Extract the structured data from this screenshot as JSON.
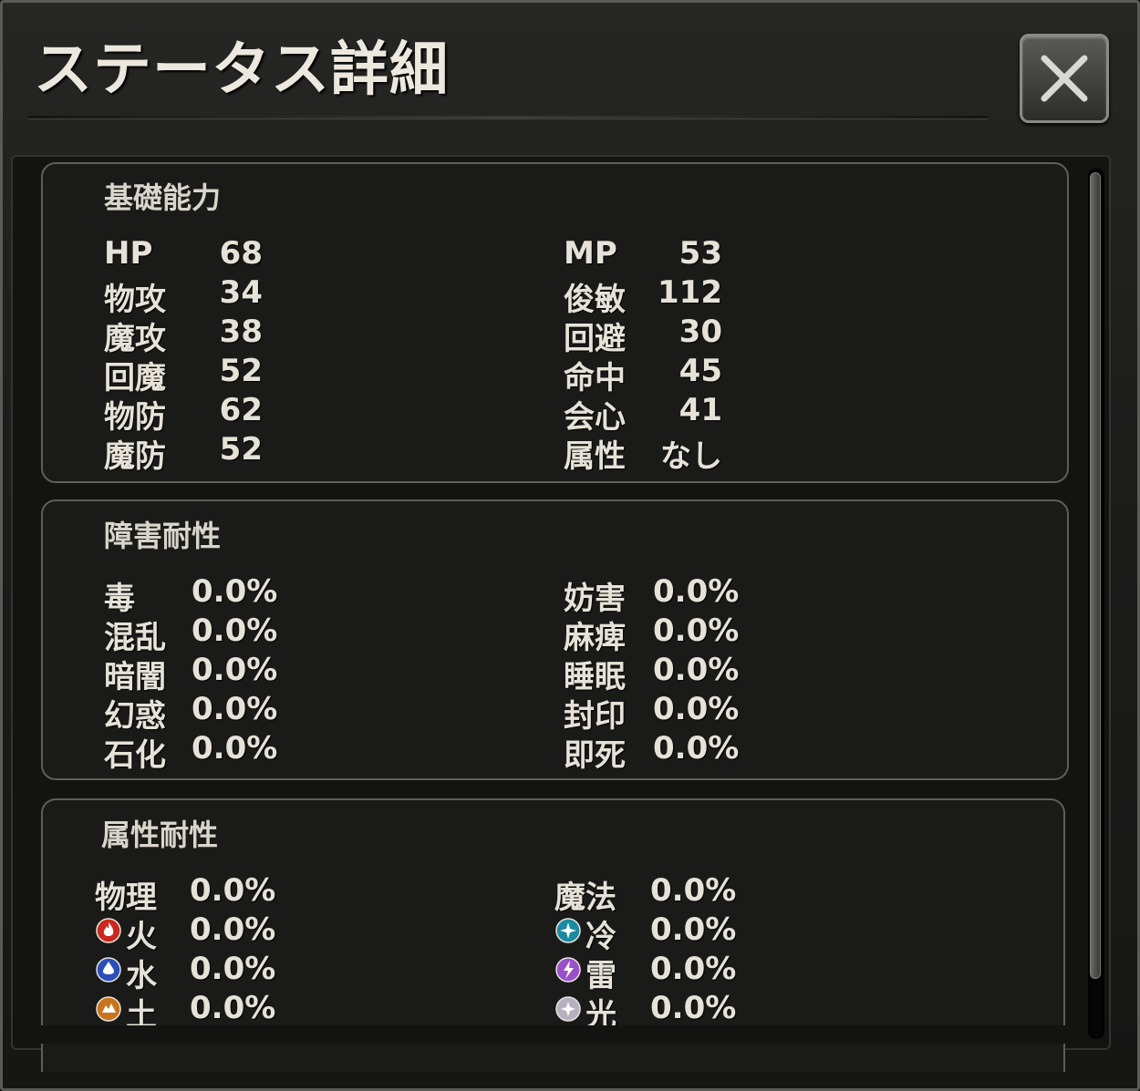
{
  "window": {
    "title": "ステータス詳細"
  },
  "basic": {
    "title": "基礎能力",
    "left": [
      {
        "label": "HP",
        "value": "68"
      },
      {
        "label": "物攻",
        "value": "34"
      },
      {
        "label": "魔攻",
        "value": "38"
      },
      {
        "label": "回魔",
        "value": "52"
      },
      {
        "label": "物防",
        "value": "62"
      },
      {
        "label": "魔防",
        "value": "52"
      }
    ],
    "right": [
      {
        "label": "MP",
        "value": "53"
      },
      {
        "label": "俊敏",
        "value": "112"
      },
      {
        "label": "回避",
        "value": "30"
      },
      {
        "label": "命中",
        "value": "45"
      },
      {
        "label": "会心",
        "value": "41"
      },
      {
        "label": "属性",
        "value": "なし"
      }
    ]
  },
  "ailment": {
    "title": "障害耐性",
    "left": [
      {
        "label": "毒",
        "value": "0.0%"
      },
      {
        "label": "混乱",
        "value": "0.0%"
      },
      {
        "label": "暗闇",
        "value": "0.0%"
      },
      {
        "label": "幻惑",
        "value": "0.0%"
      },
      {
        "label": "石化",
        "value": "0.0%"
      }
    ],
    "right": [
      {
        "label": "妨害",
        "value": "0.0%"
      },
      {
        "label": "麻痺",
        "value": "0.0%"
      },
      {
        "label": "睡眠",
        "value": "0.0%"
      },
      {
        "label": "封印",
        "value": "0.0%"
      },
      {
        "label": "即死",
        "value": "0.0%"
      }
    ]
  },
  "element": {
    "title": "属性耐性",
    "left": [
      {
        "label": "物理",
        "value": "0.0%",
        "icon": "none"
      },
      {
        "label": "火",
        "value": "0.0%",
        "icon": "fire-icon",
        "color": "#c8281e"
      },
      {
        "label": "水",
        "value": "0.0%",
        "icon": "water-icon",
        "color": "#2a4fb8"
      },
      {
        "label": "土",
        "value": "0.0%",
        "icon": "earth-icon",
        "color": "#c8741c"
      }
    ],
    "right": [
      {
        "label": "魔法",
        "value": "0.0%",
        "icon": "none"
      },
      {
        "label": "冷",
        "value": "0.0%",
        "icon": "ice-icon",
        "color": "#1a8aa0"
      },
      {
        "label": "雷",
        "value": "0.0%",
        "icon": "thunder-icon",
        "color": "#9a50c8"
      },
      {
        "label": "光",
        "value": "0.0%",
        "icon": "light-icon",
        "color": "#b8b0c0"
      }
    ]
  },
  "close_icon": "close-icon"
}
